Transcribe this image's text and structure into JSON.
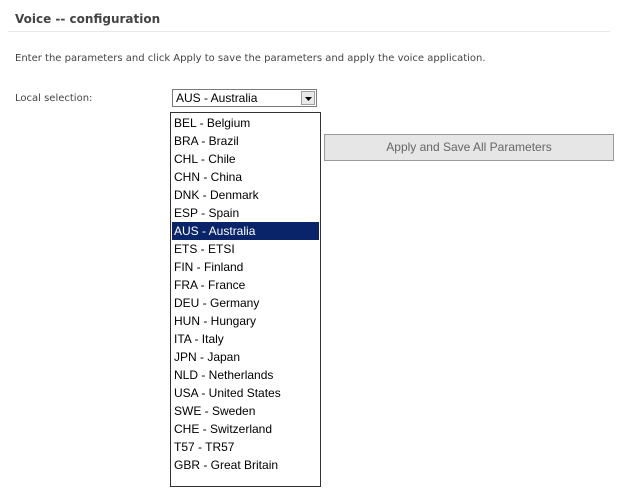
{
  "page": {
    "title": "Voice -- configuration",
    "instructions": "Enter the parameters and click Apply to save the parameters and apply the voice application."
  },
  "locale": {
    "label": "Local selection:",
    "selected": "AUS - Australia",
    "options": [
      "BEL - Belgium",
      "BRA - Brazil",
      "CHL - Chile",
      "CHN - China",
      "DNK - Denmark",
      "ESP - Spain",
      "AUS - Australia",
      "ETS - ETSI",
      "FIN - Finland",
      "FRA - France",
      "DEU - Germany",
      "HUN - Hungary",
      "ITA - Italy",
      "JPN - Japan",
      "NLD - Netherlands",
      "USA - United States",
      "SWE - Sweden",
      "CHE - Switzerland",
      "T57 - TR57",
      "GBR - Great Britain"
    ],
    "highlighted_option": "AUS - Australia",
    "dropdown_icon": "chevron-down-icon"
  },
  "actions": {
    "apply_label": "Apply and Save All Parameters"
  },
  "colors": {
    "highlight": "#0a246a",
    "button_background": "#e6e6e6"
  }
}
